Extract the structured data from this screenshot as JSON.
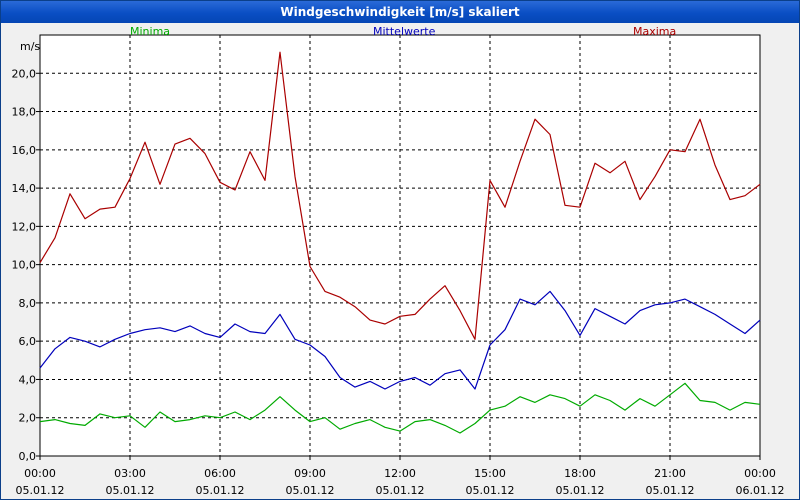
{
  "window": {
    "title": "Windgeschwindigkeit [m/s] skaliert"
  },
  "colors": {
    "minima": "#00aa00",
    "mittel": "#0000bb",
    "maxima": "#aa0000",
    "grid": "#000000",
    "titlebar": "#0a4ec4"
  },
  "chart_data": {
    "type": "line",
    "title": "Windgeschwindigkeit [m/s] skaliert",
    "ylabel": "m/s",
    "ylim": [
      0,
      22
    ],
    "yticks": [
      0,
      2,
      4,
      6,
      8,
      10,
      12,
      14,
      16,
      18,
      20
    ],
    "ytick_labels": [
      "0,0",
      "2,0",
      "4,0",
      "6,0",
      "8,0",
      "10,0",
      "12,0",
      "14,0",
      "16,0",
      "18,0",
      "20,0"
    ],
    "xlim": [
      "05.01.12 00:00",
      "06.01.12 00:00"
    ],
    "xticks": [
      {
        "time": "00:00",
        "date": "05.01.12"
      },
      {
        "time": "03:00",
        "date": "05.01.12"
      },
      {
        "time": "06:00",
        "date": "05.01.12"
      },
      {
        "time": "09:00",
        "date": "05.01.12"
      },
      {
        "time": "12:00",
        "date": "05.01.12"
      },
      {
        "time": "15:00",
        "date": "05.01.12"
      },
      {
        "time": "18:00",
        "date": "05.01.12"
      },
      {
        "time": "21:00",
        "date": "05.01.12"
      },
      {
        "time": "00:00",
        "date": "06.01.12"
      }
    ],
    "grid": true,
    "legend_position": "top",
    "series": [
      {
        "name": "Minima",
        "color": "#00aa00",
        "points": [
          [
            "05.01.12 00:00",
            1.8
          ],
          [
            "05.01.12 00:30",
            1.9
          ],
          [
            "05.01.12 01:00",
            1.7
          ],
          [
            "05.01.12 01:30",
            1.6
          ],
          [
            "05.01.12 02:00",
            2.2
          ],
          [
            "05.01.12 02:30",
            2.0
          ],
          [
            "05.01.12 03:00",
            2.1
          ],
          [
            "05.01.12 03:30",
            1.5
          ],
          [
            "05.01.12 04:00",
            2.3
          ],
          [
            "05.01.12 04:30",
            1.8
          ],
          [
            "05.01.12 05:00",
            1.9
          ],
          [
            "05.01.12 05:30",
            2.1
          ],
          [
            "05.01.12 06:00",
            2.0
          ],
          [
            "05.01.12 06:30",
            2.3
          ],
          [
            "05.01.12 07:00",
            1.9
          ],
          [
            "05.01.12 07:30",
            2.4
          ],
          [
            "05.01.12 08:00",
            3.1
          ],
          [
            "05.01.12 08:30",
            2.4
          ],
          [
            "05.01.12 09:00",
            1.8
          ],
          [
            "05.01.12 09:30",
            2.0
          ],
          [
            "05.01.12 10:00",
            1.4
          ],
          [
            "05.01.12 10:30",
            1.7
          ],
          [
            "05.01.12 11:00",
            1.9
          ],
          [
            "05.01.12 11:30",
            1.5
          ],
          [
            "05.01.12 12:00",
            1.3
          ],
          [
            "05.01.12 12:30",
            1.8
          ],
          [
            "05.01.12 13:00",
            1.9
          ],
          [
            "05.01.12 13:30",
            1.6
          ],
          [
            "05.01.12 14:00",
            1.2
          ],
          [
            "05.01.12 14:30",
            1.7
          ],
          [
            "05.01.12 15:00",
            2.4
          ],
          [
            "05.01.12 15:30",
            2.6
          ],
          [
            "05.01.12 16:00",
            3.1
          ],
          [
            "05.01.12 16:30",
            2.8
          ],
          [
            "05.01.12 17:00",
            3.2
          ],
          [
            "05.01.12 17:30",
            3.0
          ],
          [
            "05.01.12 18:00",
            2.6
          ],
          [
            "05.01.12 18:30",
            3.2
          ],
          [
            "05.01.12 19:00",
            2.9
          ],
          [
            "05.01.12 19:30",
            2.4
          ],
          [
            "05.01.12 20:00",
            3.0
          ],
          [
            "05.01.12 20:30",
            2.6
          ],
          [
            "05.01.12 21:00",
            3.2
          ],
          [
            "05.01.12 21:30",
            3.8
          ],
          [
            "05.01.12 22:00",
            2.9
          ],
          [
            "05.01.12 22:30",
            2.8
          ],
          [
            "05.01.12 23:00",
            2.4
          ],
          [
            "05.01.12 23:30",
            2.8
          ],
          [
            "06.01.12 00:00",
            2.7
          ]
        ]
      },
      {
        "name": "Mittelwerte",
        "color": "#0000bb",
        "points": [
          [
            "05.01.12 00:00",
            4.6
          ],
          [
            "05.01.12 00:30",
            5.6
          ],
          [
            "05.01.12 01:00",
            6.2
          ],
          [
            "05.01.12 01:30",
            6.0
          ],
          [
            "05.01.12 02:00",
            5.7
          ],
          [
            "05.01.12 02:30",
            6.1
          ],
          [
            "05.01.12 03:00",
            6.4
          ],
          [
            "05.01.12 03:30",
            6.6
          ],
          [
            "05.01.12 04:00",
            6.7
          ],
          [
            "05.01.12 04:30",
            6.5
          ],
          [
            "05.01.12 05:00",
            6.8
          ],
          [
            "05.01.12 05:30",
            6.4
          ],
          [
            "05.01.12 06:00",
            6.2
          ],
          [
            "05.01.12 06:30",
            6.9
          ],
          [
            "05.01.12 07:00",
            6.5
          ],
          [
            "05.01.12 07:30",
            6.4
          ],
          [
            "05.01.12 08:00",
            7.4
          ],
          [
            "05.01.12 08:30",
            6.1
          ],
          [
            "05.01.12 09:00",
            5.8
          ],
          [
            "05.01.12 09:30",
            5.2
          ],
          [
            "05.01.12 10:00",
            4.1
          ],
          [
            "05.01.12 10:30",
            3.6
          ],
          [
            "05.01.12 11:00",
            3.9
          ],
          [
            "05.01.12 11:30",
            3.5
          ],
          [
            "05.01.12 12:00",
            3.9
          ],
          [
            "05.01.12 12:30",
            4.1
          ],
          [
            "05.01.12 13:00",
            3.7
          ],
          [
            "05.01.12 13:30",
            4.3
          ],
          [
            "05.01.12 14:00",
            4.5
          ],
          [
            "05.01.12 14:30",
            3.5
          ],
          [
            "05.01.12 15:00",
            5.8
          ],
          [
            "05.01.12 15:30",
            6.6
          ],
          [
            "05.01.12 16:00",
            8.2
          ],
          [
            "05.01.12 16:30",
            7.9
          ],
          [
            "05.01.12 17:00",
            8.6
          ],
          [
            "05.01.12 17:30",
            7.6
          ],
          [
            "05.01.12 18:00",
            6.3
          ],
          [
            "05.01.12 18:30",
            7.7
          ],
          [
            "05.01.12 19:00",
            7.3
          ],
          [
            "05.01.12 19:30",
            6.9
          ],
          [
            "05.01.12 20:00",
            7.6
          ],
          [
            "05.01.12 20:30",
            7.9
          ],
          [
            "05.01.12 21:00",
            8.0
          ],
          [
            "05.01.12 21:30",
            8.2
          ],
          [
            "05.01.12 22:00",
            7.8
          ],
          [
            "05.01.12 22:30",
            7.4
          ],
          [
            "05.01.12 23:00",
            6.9
          ],
          [
            "05.01.12 23:30",
            6.4
          ],
          [
            "06.01.12 00:00",
            7.1
          ]
        ]
      },
      {
        "name": "Maxima",
        "color": "#aa0000",
        "points": [
          [
            "05.01.12 00:00",
            10.1
          ],
          [
            "05.01.12 00:30",
            11.4
          ],
          [
            "05.01.12 01:00",
            13.7
          ],
          [
            "05.01.12 01:30",
            12.4
          ],
          [
            "05.01.12 02:00",
            12.9
          ],
          [
            "05.01.12 02:30",
            13.0
          ],
          [
            "05.01.12 03:00",
            14.5
          ],
          [
            "05.01.12 03:30",
            16.4
          ],
          [
            "05.01.12 04:00",
            14.2
          ],
          [
            "05.01.12 04:30",
            16.3
          ],
          [
            "05.01.12 05:00",
            16.6
          ],
          [
            "05.01.12 05:30",
            15.8
          ],
          [
            "05.01.12 06:00",
            14.3
          ],
          [
            "05.01.12 06:30",
            13.9
          ],
          [
            "05.01.12 07:00",
            15.9
          ],
          [
            "05.01.12 07:30",
            14.4
          ],
          [
            "05.01.12 08:00",
            21.1
          ],
          [
            "05.01.12 08:30",
            14.6
          ],
          [
            "05.01.12 09:00",
            9.9
          ],
          [
            "05.01.12 09:30",
            8.6
          ],
          [
            "05.01.12 10:00",
            8.3
          ],
          [
            "05.01.12 10:30",
            7.8
          ],
          [
            "05.01.12 11:00",
            7.1
          ],
          [
            "05.01.12 11:30",
            6.9
          ],
          [
            "05.01.12 12:00",
            7.3
          ],
          [
            "05.01.12 12:30",
            7.4
          ],
          [
            "05.01.12 13:00",
            8.2
          ],
          [
            "05.01.12 13:30",
            8.9
          ],
          [
            "05.01.12 14:00",
            7.6
          ],
          [
            "05.01.12 14:30",
            6.1
          ],
          [
            "05.01.12 15:00",
            14.4
          ],
          [
            "05.01.12 15:30",
            13.0
          ],
          [
            "05.01.12 16:00",
            15.4
          ],
          [
            "05.01.12 16:30",
            17.6
          ],
          [
            "05.01.12 17:00",
            16.8
          ],
          [
            "05.01.12 17:30",
            13.1
          ],
          [
            "05.01.12 18:00",
            13.0
          ],
          [
            "05.01.12 18:30",
            15.3
          ],
          [
            "05.01.12 19:00",
            14.8
          ],
          [
            "05.01.12 19:30",
            15.4
          ],
          [
            "05.01.12 20:00",
            13.4
          ],
          [
            "05.01.12 20:30",
            14.6
          ],
          [
            "05.01.12 21:00",
            16.0
          ],
          [
            "05.01.12 21:30",
            15.9
          ],
          [
            "05.01.12 22:00",
            17.6
          ],
          [
            "05.01.12 22:30",
            15.2
          ],
          [
            "05.01.12 23:00",
            13.4
          ],
          [
            "05.01.12 23:30",
            13.6
          ],
          [
            "06.01.12 00:00",
            14.2
          ]
        ]
      }
    ]
  }
}
